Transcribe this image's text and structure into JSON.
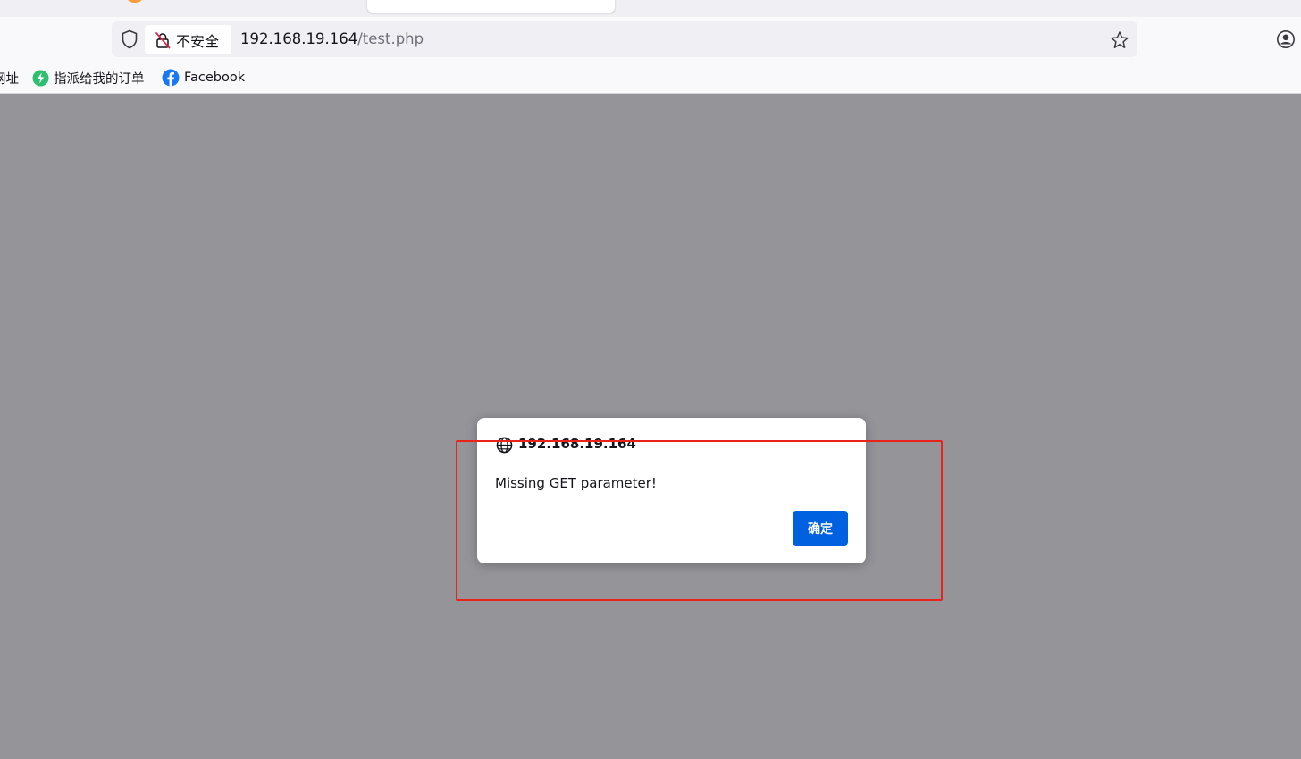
{
  "browser": {
    "address_bar": {
      "security_label": "不安全",
      "url_host": "192.168.19.164",
      "url_path": "/test.php"
    },
    "bookmarks": [
      {
        "label": "网址",
        "icon": "bookmark-icon"
      },
      {
        "label": "指派给我的订单",
        "icon": "lightning-icon",
        "icon_color": "#2fbf71"
      },
      {
        "label": "Facebook",
        "icon": "facebook-icon",
        "icon_color": "#1877f2"
      }
    ]
  },
  "alert": {
    "origin": "192.168.19.164",
    "message": "Missing GET parameter!",
    "ok_label": "确定",
    "ok_color": "#0061e0"
  },
  "annotation": {
    "highlight_color": "#e8231c"
  }
}
